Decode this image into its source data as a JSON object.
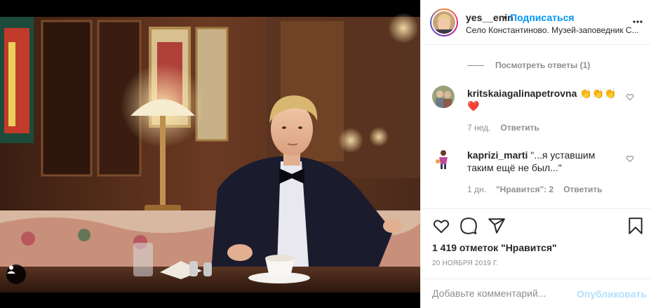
{
  "post": {
    "username": "yes__enin",
    "separator": "•",
    "follow_label": "Подписаться",
    "location": "Село Константиново. Музей-заповедник С...",
    "more_icon": "more-options-icon"
  },
  "thread": {
    "view_replies_label": "Посмотреть ответы (1)"
  },
  "comments": [
    {
      "username": "kritskaiagalinapetrovna",
      "text": "👏👏👏❤️",
      "time": "7 нед.",
      "reply_label": "Ответить"
    },
    {
      "username": "kaprizi_marti",
      "text": "\"...я уставшим таким ещё не был...\"",
      "time": "1 дн.",
      "likes_label": "\"Нравится\": 2",
      "reply_label": "Ответить"
    }
  ],
  "footer": {
    "likes_text": "1 419 отметок \"Нравится\"",
    "date_text": "20 НОЯБРЯ 2019 Г.",
    "comment_placeholder": "Добавьте комментарий...",
    "publish_label": "Опубликовать"
  },
  "colors": {
    "accent": "#0095f6",
    "publish_disabled": "#b2dffc",
    "muted": "#8e8e8e",
    "text": "#262626",
    "heart": "#ed4956"
  }
}
